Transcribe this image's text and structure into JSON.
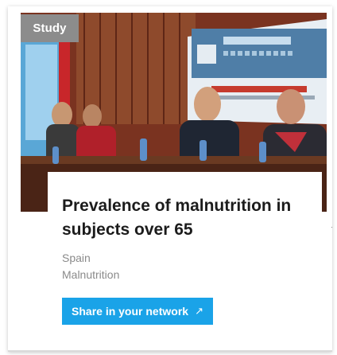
{
  "card": {
    "tag": "Study",
    "title": "Prevalence of malnutrition in subjects over 65",
    "country": "Spain",
    "topic": "Malnutrition",
    "share_label": "Share in your network",
    "share_icon": "external-arrow-icon",
    "photo": {
      "description_tags": [
        "conference-panel",
        "presenters-at-table",
        "banner"
      ],
      "banner_brand": "másnutridos",
      "banner_lines": [
        "Alianza Desnutrición Cero",
        "en Hospitales, Residencias y la comunidad"
      ]
    }
  },
  "colors": {
    "tag_bg": "#8c8c8c",
    "share_bg": "#1aa3e8",
    "title": "#1c1c1c",
    "meta": "#8a8a8a"
  }
}
